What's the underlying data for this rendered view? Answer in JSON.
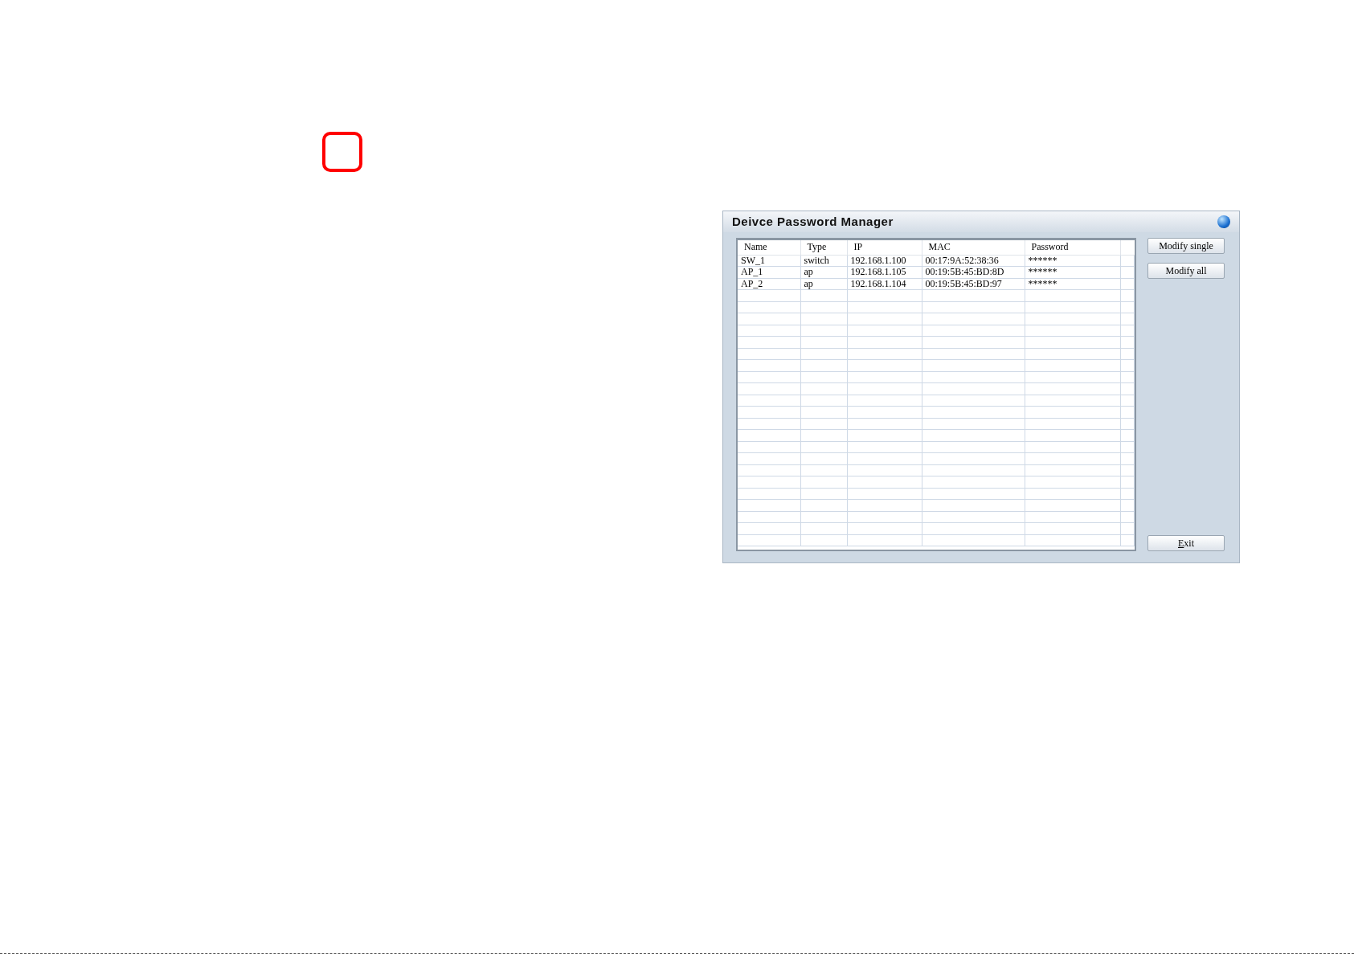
{
  "window": {
    "title": "Deivce Password Manager"
  },
  "table": {
    "columns": [
      "Name",
      "Type",
      "IP",
      "MAC",
      "Password"
    ],
    "rows": [
      {
        "cells": [
          "SW_1",
          "switch",
          "192.168.1.100",
          "00:17:9A:52:38:36",
          "******"
        ]
      },
      {
        "cells": [
          "AP_1",
          "ap",
          "192.168.1.105",
          "00:19:5B:45:BD:8D",
          "******"
        ]
      },
      {
        "cells": [
          "AP_2",
          "ap",
          "192.168.1.104",
          "00:19:5B:45:BD:97",
          "******"
        ]
      }
    ]
  },
  "buttons": [
    {
      "label": "Modify single",
      "kind": "top"
    },
    {
      "label": "Modify all",
      "kind": "top"
    },
    {
      "label": "Exit",
      "kind": "bottom"
    }
  ]
}
